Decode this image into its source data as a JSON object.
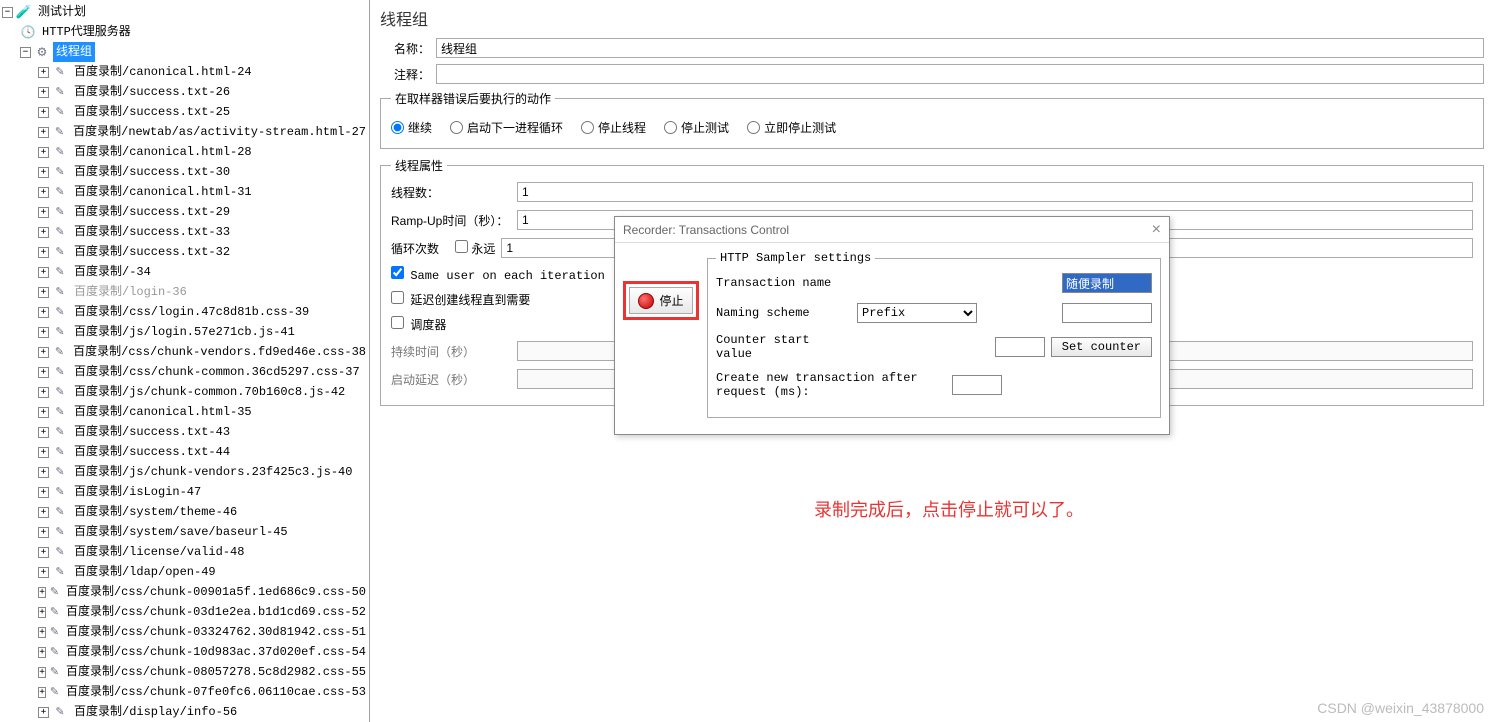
{
  "tree": {
    "root_label": "测试计划",
    "http_proxy_label": "HTTP代理服务器",
    "thread_group_label": "线程组",
    "items": [
      {
        "l": "百度录制/canonical.html-24"
      },
      {
        "l": "百度录制/success.txt-26"
      },
      {
        "l": "百度录制/success.txt-25"
      },
      {
        "l": "百度录制/newtab/as/activity-stream.html-27"
      },
      {
        "l": "百度录制/canonical.html-28"
      },
      {
        "l": "百度录制/success.txt-30"
      },
      {
        "l": "百度录制/canonical.html-31"
      },
      {
        "l": "百度录制/success.txt-29"
      },
      {
        "l": "百度录制/success.txt-33"
      },
      {
        "l": "百度录制/success.txt-32"
      },
      {
        "l": "百度录制/-34"
      },
      {
        "l": "百度录制/login-36",
        "gray": true
      },
      {
        "l": "百度录制/css/login.47c8d81b.css-39"
      },
      {
        "l": "百度录制/js/login.57e271cb.js-41"
      },
      {
        "l": "百度录制/css/chunk-vendors.fd9ed46e.css-38"
      },
      {
        "l": "百度录制/css/chunk-common.36cd5297.css-37"
      },
      {
        "l": "百度录制/js/chunk-common.70b160c8.js-42"
      },
      {
        "l": "百度录制/canonical.html-35"
      },
      {
        "l": "百度录制/success.txt-43"
      },
      {
        "l": "百度录制/success.txt-44"
      },
      {
        "l": "百度录制/js/chunk-vendors.23f425c3.js-40"
      },
      {
        "l": "百度录制/isLogin-47"
      },
      {
        "l": "百度录制/system/theme-46"
      },
      {
        "l": "百度录制/system/save/baseurl-45"
      },
      {
        "l": "百度录制/license/valid-48"
      },
      {
        "l": "百度录制/ldap/open-49"
      },
      {
        "l": "百度录制/css/chunk-00901a5f.1ed686c9.css-50"
      },
      {
        "l": "百度录制/css/chunk-03d1e2ea.b1d1cd69.css-52"
      },
      {
        "l": "百度录制/css/chunk-03324762.30d81942.css-51"
      },
      {
        "l": "百度录制/css/chunk-10d983ac.37d020ef.css-54"
      },
      {
        "l": "百度录制/css/chunk-08057278.5c8d2982.css-55"
      },
      {
        "l": "百度录制/css/chunk-07fe0fc6.06110cae.css-53"
      },
      {
        "l": "百度录制/display/info-56"
      }
    ]
  },
  "main": {
    "title": "线程组",
    "name_label": "名称：",
    "name_value": "线程组",
    "comment_label": "注释：",
    "comment_value": "",
    "error_fieldset": {
      "legend": "在取样器错误后要执行的动作",
      "options": [
        "继续",
        "启动下一进程循环",
        "停止线程",
        "停止测试",
        "立即停止测试"
      ],
      "selected": 0
    },
    "thread_props": {
      "legend": "线程属性",
      "threads_label": "线程数：",
      "threads_value": "1",
      "rampup_label": "Ramp-Up时间（秒）：",
      "rampup_value": "1",
      "loop_label": "循环次数",
      "forever_label": "永远",
      "loop_value": "1",
      "same_user_label": "Same user on each iteration",
      "same_user_checked": true,
      "delay_thread_label": "延迟创建线程直到需要",
      "scheduler_label": "调度器",
      "duration_label": "持续时间（秒）",
      "startup_delay_label": "启动延迟（秒）"
    }
  },
  "dialog": {
    "title": "Recorder: Transactions Control",
    "stop_label": "停止",
    "settings_legend": "HTTP Sampler settings",
    "transaction_name_label": "Transaction name",
    "transaction_name_value": "随便录制",
    "naming_scheme_label": "Naming scheme",
    "naming_scheme_value": "Prefix",
    "counter_start_label": "Counter start value",
    "counter_start_value": "",
    "set_counter_label": "Set counter",
    "create_new_label": "Create new transaction after request (ms):",
    "create_new_value": ""
  },
  "annotation": "录制完成后，点击停止就可以了。",
  "watermark": "CSDN @weixin_43878000"
}
